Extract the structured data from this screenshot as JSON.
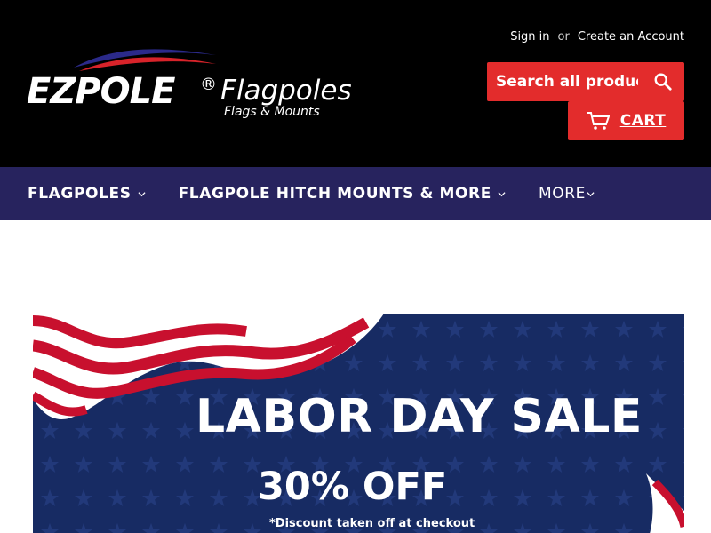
{
  "header": {
    "sign_in": "Sign in",
    "or": "or",
    "create_account": "Create an Account"
  },
  "logo": {
    "brand": "EZPOLE",
    "registered": "®",
    "product": "Flagpoles",
    "tagline": "Flags & Mounts"
  },
  "search": {
    "placeholder": "Search all products...",
    "icon": "search-icon"
  },
  "cart": {
    "label": "CART",
    "icon": "cart-icon"
  },
  "nav": {
    "items": [
      {
        "label": "FLAGPOLES"
      },
      {
        "label": "FLAGPOLE HITCH MOUNTS & MORE"
      },
      {
        "label": "MORE"
      }
    ]
  },
  "banner": {
    "title": "LABOR DAY SALE",
    "offer": "30% OFF",
    "note": "*Discount taken off at checkout"
  },
  "colors": {
    "header_bg": "#000000",
    "nav_bg": "#27235e",
    "accent_red": "#e32c2c",
    "banner_blue": "#172b63"
  }
}
